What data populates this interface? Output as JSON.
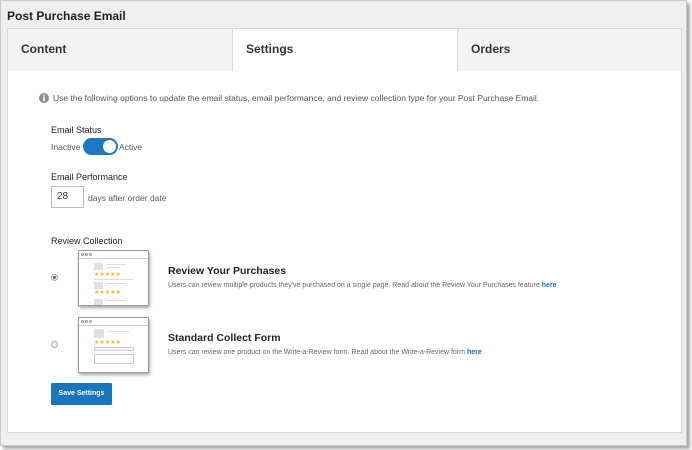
{
  "window": {
    "title": "Post Purchase Email"
  },
  "tabs": [
    {
      "label": "Content"
    },
    {
      "label": "Settings"
    },
    {
      "label": "Orders"
    }
  ],
  "info_text": "Use the following options to update the email status, email performance, and review collection type for your Post Purchase Email.",
  "email_status": {
    "label": "Email Status",
    "off_label": "Inactive",
    "on_label": "Active",
    "enabled": true
  },
  "email_performance": {
    "label": "Email Performance",
    "days_value": "28",
    "suffix": "days after order date"
  },
  "review_collection": {
    "label": "Review Collection",
    "options": [
      {
        "title": "Review Your Purchases",
        "description": "Users can review multiple products they've purchased on a single page. Read about the Review Your Purchases feature",
        "link": "here",
        "selected": true
      },
      {
        "title": "Standard Collect Form",
        "description": "Users can review one product on the Write-a-Review form. Read about the Write-a-Review form",
        "link": "here",
        "selected": false
      }
    ]
  },
  "save_button": {
    "label": "Save Settings"
  },
  "colors": {
    "accent": "#1a79c2",
    "star": "#f2b42b",
    "link": "#1a6fb5"
  },
  "icons": {
    "info": "info-circle-icon",
    "star": "star-icon"
  },
  "glyphs": {
    "info": "i",
    "five_stars": "★★★★★"
  }
}
